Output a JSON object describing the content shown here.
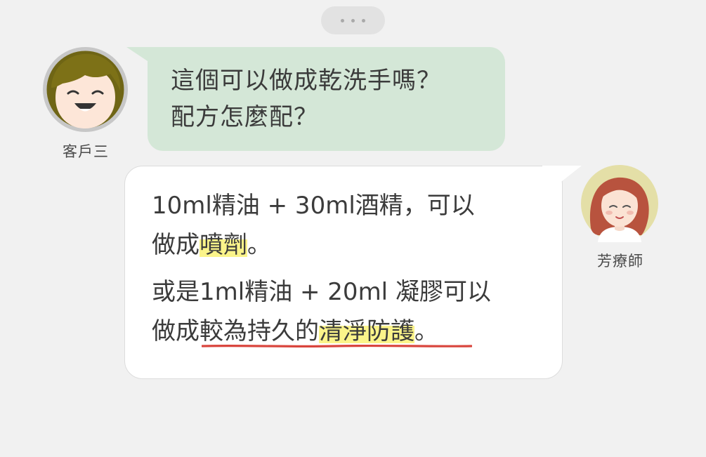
{
  "customer": {
    "name": "客戶三",
    "message_lines": [
      "這個可以做成乾洗手嗎？",
      "配方怎麼配？"
    ]
  },
  "therapist": {
    "name": "芳療師",
    "para1_line1": "10ml精油 + 30ml酒精，可以",
    "para1_line2_prefix": "做成",
    "para1_line2_highlight": "噴劑",
    "para1_line2_suffix": "。",
    "para2_line1": "或是1ml精油 + 20ml 凝膠可以",
    "para2_line2_prefix": "做成較為持久的",
    "para2_line2_highlight": "清淨防護",
    "para2_line2_suffix": "。"
  },
  "colors": {
    "background": "#f1f1f1",
    "customer_bubble": "#d4e7d7",
    "therapist_bubble": "#ffffff",
    "highlight": "#fbf48a",
    "underline": "#d9453d"
  },
  "icons": [
    "typing-indicator-icon",
    "customer-avatar",
    "therapist-avatar"
  ]
}
